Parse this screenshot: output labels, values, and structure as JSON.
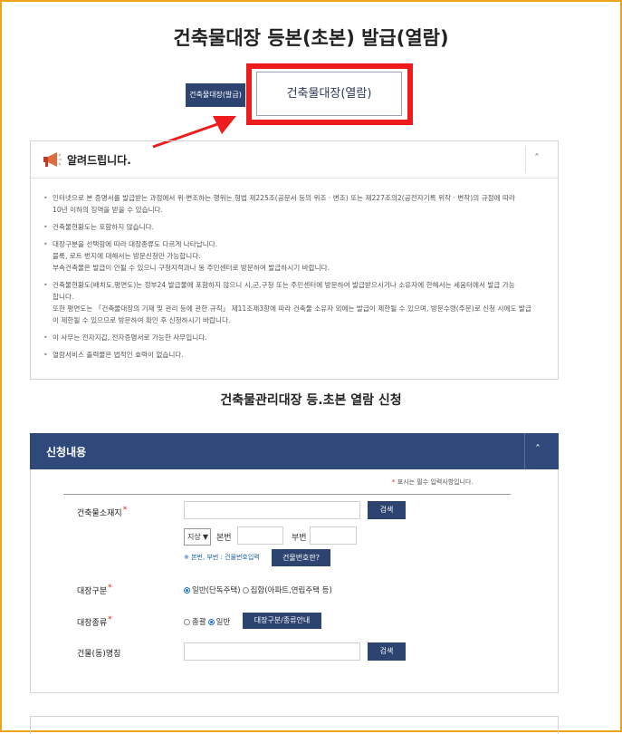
{
  "page": {
    "title": "건축물대장 등본(초본) 발급(열람)"
  },
  "tabs": {
    "issue_label": "건축물대장(발급)",
    "view_label": "건축물대장(열람)"
  },
  "notice": {
    "title": "알려드립니다.",
    "toggle": "ˆ",
    "items": [
      {
        "line1": "인터넷으로 본 증명서를 발급받는 과정에서 위·변조하는 행위는 형법 제225조(공문서 등의 위조 · 변조) 또는 제227조의2(공전자기록 위작 · 변작)의 규정에 따라",
        "line2": "10년 이하의 징역을 받을 수 있습니다."
      },
      {
        "line1": "건축물현황도는 포함하지 않습니다."
      },
      {
        "line1": "대장구분을 선택함에 따라 대장종류도 다르게 나타납니다.",
        "line2": "블록, 로트 번지에 대해서는 방문신청만 가능합니다.",
        "line3": "부속건축물은 발급이 안될 수 있으니 구청지적과나 동 주민센터로 방문하여 발급하시기 바랍니다."
      },
      {
        "line1": "건축물현황도(배치도,평면도)는 정부24 발급물에 포함하지 않으니 시,군,구청 또는 주민센터에 방문하여 발급받으시거나 소유자에 한해서는 세움터에서 발급 가능",
        "line2": "합니다.",
        "line3": "또한 평면도는 「건축물대장의 기재 및 관리 등에 관한 규칙」 제11조제3항에 따라 건축물 소유자 외에는 발급이 제한될 수 있으며, 방문수령(주문)로 신청 시에도 발급",
        "line4": "이 제한될 수 있으므로 방문하여 확인 후 신청하시기 바랍니다."
      },
      {
        "line1": "이 사무는 전자지갑, 전자증명서로 가능한 사무입니다."
      },
      {
        "line1": "열람서비스 출력물은 법적인 효력이 없습니다."
      }
    ]
  },
  "section": {
    "title": "건축물관리대장 등.초본 열람 신청"
  },
  "panel": {
    "title": "신청내용",
    "toggle": "ˆ",
    "required_note_star": "*",
    "required_note": " 표시는 필수 입력사항입니다.",
    "fields": {
      "address": {
        "label": "건축물소재지",
        "req": "*",
        "search_button": "검색",
        "select_value": "지상",
        "main_no_label": "본번",
        "sub_no_label": "부번",
        "hint": "※ 본번, 부번 : 건물번호입력",
        "bldg_no_button": "건물번호란?"
      },
      "register_type": {
        "label": "대장구분",
        "req": "*",
        "option1": "일반(단독주택)",
        "option2": "집합(아파트,연립주택 등)"
      },
      "register_kind": {
        "label": "대장종류",
        "req": "*",
        "option1": "총괄",
        "option2": "일반",
        "guide_button": "대장구분/종류안내"
      },
      "building_name": {
        "label": "건물(동)명칭",
        "search_button": "검색"
      }
    }
  },
  "colors": {
    "navy": "#2e4470",
    "highlight_red": "#ee1c1c",
    "frame_orange": "#f0a21c"
  }
}
